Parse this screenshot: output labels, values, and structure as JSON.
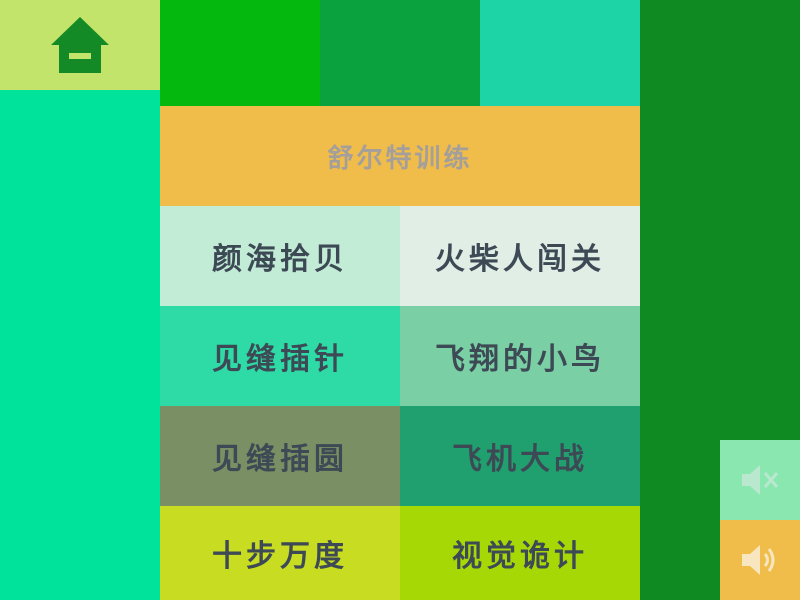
{
  "colors": {
    "home_tile": "#c3e46a",
    "left_panel": "#00e39b",
    "right_panel": "#0f8a22",
    "title_bar": "#f0bd4a",
    "tile_text": "#3d4a55",
    "title_text": "#a49f9a"
  },
  "icons": {
    "home": "home-icon",
    "mute": "speaker-mute-icon",
    "volume": "speaker-volume-icon"
  },
  "menu": {
    "title": "舒尔特训练",
    "games": [
      {
        "label": "颜海拾贝"
      },
      {
        "label": "火柴人闯关"
      },
      {
        "label": "见缝插针"
      },
      {
        "label": "飞翔的小鸟"
      },
      {
        "label": "见缝插圆"
      },
      {
        "label": "飞机大战"
      },
      {
        "label": "十步万度"
      },
      {
        "label": "视觉诡计"
      }
    ]
  }
}
